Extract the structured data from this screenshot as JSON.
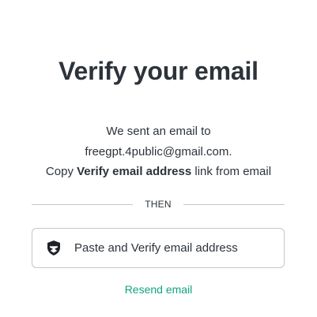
{
  "header": {
    "title": "Verify your email"
  },
  "message": {
    "line1": "We sent an email to",
    "email": "freegpt.4public@gmail.com.",
    "line3_prefix": "Copy ",
    "line3_bold": "Verify email address",
    "line3_suffix": " link from email"
  },
  "divider": {
    "label": "THEN"
  },
  "verify_button": {
    "label": "Paste and Verify email address",
    "icon": "shield-icon"
  },
  "resend": {
    "label": "Resend email"
  },
  "colors": {
    "text": "#2d333a",
    "border": "#c2c8d0",
    "accent": "#10a37f"
  }
}
